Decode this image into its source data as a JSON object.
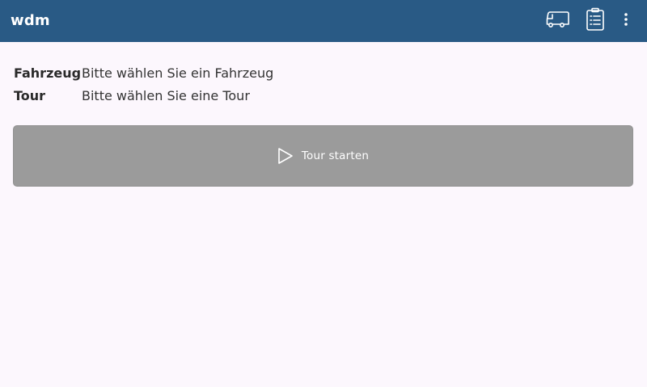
{
  "appbar": {
    "title": "wdm",
    "background": "#295a85",
    "actions": [
      {
        "icon": "truck-icon"
      },
      {
        "icon": "clipboard-list-icon"
      },
      {
        "icon": "more-vert-icon"
      }
    ]
  },
  "info": {
    "vehicle_label": "Fahrzeug",
    "vehicle_value": "Bitte wählen Sie ein Fahrzeug",
    "tour_label": "Tour",
    "tour_value": "Bitte wählen Sie eine Tour"
  },
  "start_button": {
    "icon": "play-icon",
    "label": "Tour starten",
    "background": "#9b9b9b"
  }
}
